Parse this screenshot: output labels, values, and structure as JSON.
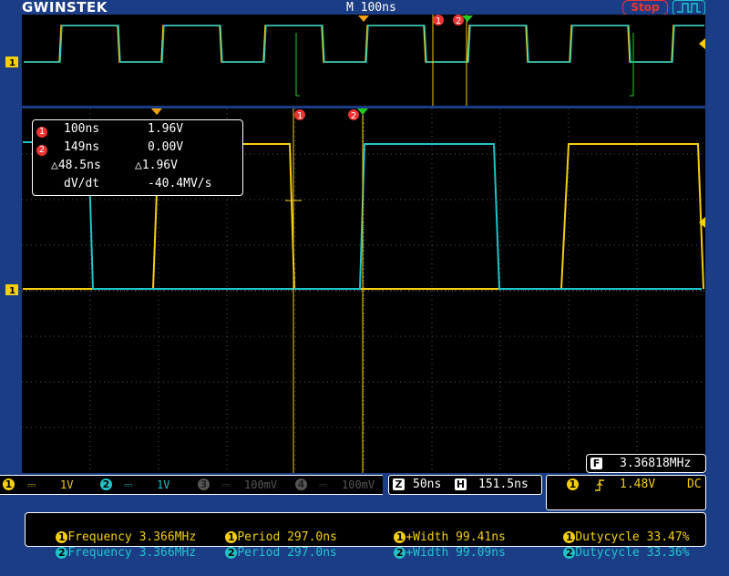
{
  "header": {
    "brand": "GWINSTEK",
    "timebase": "M 100ns",
    "run_state": "Stop"
  },
  "colors": {
    "ch1": "#f5cf0a",
    "ch2": "#20c4c8",
    "cursor_marker": "#e33"
  },
  "cursors": {
    "c1_id": "1",
    "c2_id": "2",
    "row1": {
      "time": "100ns",
      "volt": "1.96V"
    },
    "row2": {
      "time": "149ns",
      "volt": "0.00V"
    },
    "delta_time": "△48.5ns",
    "delta_volt": "△1.96V",
    "slope_label": "dV/dt",
    "slope_value": "-40.4MV/s"
  },
  "frequency_counter": {
    "icon": "F",
    "value": "3.36818MHz"
  },
  "channels": [
    {
      "id": "1",
      "coupling": "⎓",
      "scale": "1V",
      "active": true
    },
    {
      "id": "2",
      "coupling": "⎓",
      "scale": "1V",
      "active": true
    },
    {
      "id": "3",
      "coupling": "⎓",
      "scale": "100mV",
      "active": false
    },
    {
      "id": "4",
      "coupling": "⎓",
      "scale": "100mV",
      "active": false
    }
  ],
  "zoom": {
    "z_icon": "Z",
    "z_value": "50ns",
    "h_icon": "H",
    "h_value": "151.5ns"
  },
  "trigger": {
    "source": "1",
    "slope_icon": "rising-edge-icon",
    "level": "1.48V",
    "coupling": "DC"
  },
  "measurements": [
    {
      "ch": "1",
      "frequency": "Frequency 3.366MHz",
      "period": "Period 297.0ns",
      "width": "+Width 99.41ns",
      "duty": "Dutycycle 33.47%"
    },
    {
      "ch": "2",
      "frequency": "Frequency 3.366MHz",
      "period": "Period 297.0ns",
      "width": "+Width 99.09ns",
      "duty": "Dutycycle 33.36%"
    }
  ]
}
